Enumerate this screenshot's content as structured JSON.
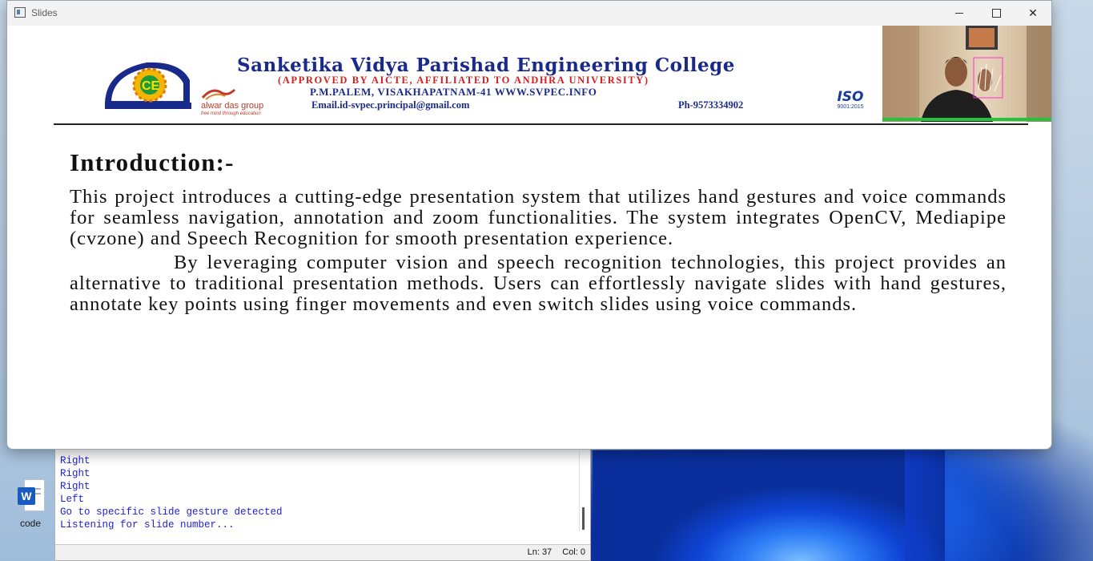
{
  "window": {
    "title": "Slides",
    "minimize_label": "",
    "maximize_label": "",
    "close_label": "✕"
  },
  "banner": {
    "college_name": "Sanketika Vidya Parishad Engineering College",
    "approval": "(APPROVED BY AICTE, AFFILIATED TO ANDHRA UNIVERSITY)",
    "address": "P.M.PALEM, VISAKHAPATNAM-41 WWW.SVPEC.INFO",
    "email": "Email.id-svpec.principal@gmail.com",
    "phone": "Ph-9573334902",
    "sponsor": "alwar das group",
    "sponsor_tagline": "free mind through education",
    "iso_label": "ISO",
    "iso_number": "9001:2015",
    "logo_letters": "CE"
  },
  "slide": {
    "heading": "Introduction:-",
    "paragraph1": "This project introduces a cutting-edge presentation system that utilizes hand gestures and voice commands for seamless navigation, annotation and zoom functionalities. The system integrates OpenCV, Mediapipe (cvzone) and Speech Recognition for smooth presentation experience.",
    "paragraph2": "By leveraging computer vision and speech recognition technologies, this project provides an alternative to traditional presentation methods. Users can effortlessly navigate slides with hand gestures, annotate key points using finger movements and even switch slides using voice commands."
  },
  "console": {
    "lines": [
      "Right",
      "Right",
      "Right",
      "Left",
      "Go to specific slide gesture detected",
      "Listening for slide number..."
    ],
    "status_line": "Ln: 37",
    "status_col": "Col: 0"
  },
  "desktop": {
    "icon_label": "code",
    "icon_letter": "W"
  },
  "colors": {
    "title_blue": "#1a2a8a",
    "approval_red": "#d32020",
    "console_text": "#1f1fd0",
    "webcam_status": "#22c53a"
  }
}
